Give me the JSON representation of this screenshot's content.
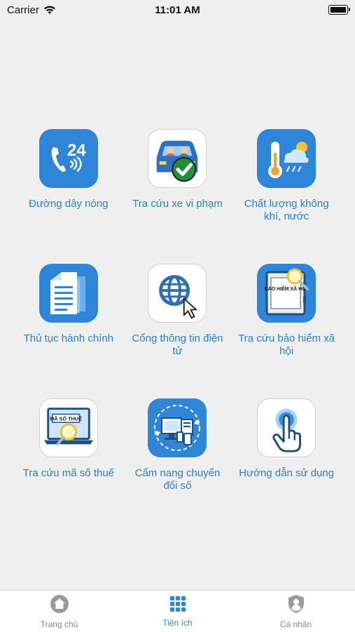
{
  "status_bar": {
    "carrier": "Carrier",
    "time": "11:01 AM"
  },
  "tiles": [
    {
      "label": "Đường dây nóng",
      "icon": "hotline-24-icon"
    },
    {
      "label": "Tra cứu xe vi phạm",
      "icon": "vehicle-violation-icon"
    },
    {
      "label": "Chất lượng không khí, nước",
      "icon": "weather-quality-icon"
    },
    {
      "label": "Thủ tục hành chính",
      "icon": "documents-icon"
    },
    {
      "label": "Cổng thông tin điện tử",
      "icon": "globe-cursor-icon"
    },
    {
      "label": "Tra cứu bảo hiểm xã hội",
      "icon": "social-insurance-icon",
      "icon_text": "BẢO HIỂM XÃ HỘI"
    },
    {
      "label": "Tra cứu mã số thuế",
      "icon": "tax-code-icon",
      "icon_text": "MÃ SỐ THUẾ"
    },
    {
      "label": "Cẩm nang chuyển đổi số",
      "icon": "digital-transform-icon"
    },
    {
      "label": "Hướng dẫn sử dụng",
      "icon": "tap-hand-icon"
    }
  ],
  "tabbar": {
    "tabs": [
      {
        "label": "Trang chủ",
        "icon": "home-icon",
        "active": false
      },
      {
        "label": "Tiện ích",
        "icon": "grid-icon",
        "active": true
      },
      {
        "label": "Cá nhân",
        "icon": "profile-shield-icon",
        "active": false
      }
    ]
  },
  "colors": {
    "accent": "#2f86d8",
    "label": "#2a7fc9",
    "background": "#efeff0"
  }
}
